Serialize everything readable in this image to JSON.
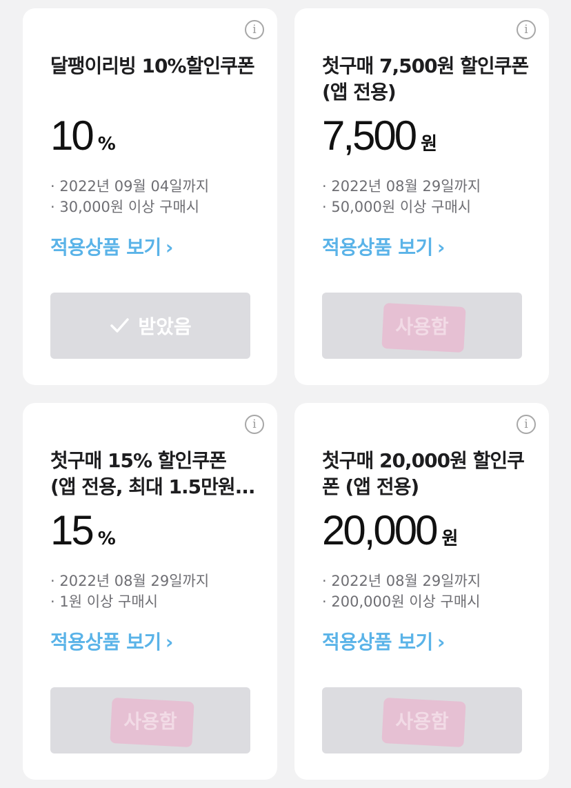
{
  "coupons": [
    {
      "title": "달팽이리빙 10%할인쿠폰",
      "amount": "10",
      "unit": "%",
      "expiry": "2022년 09월 04일까지",
      "min_purchase": "30,000원 이상 구매시",
      "link": "적용상품 보기",
      "status": "받았음",
      "status_type": "received"
    },
    {
      "title": "첫구매 7,500원 할인쿠폰 (앱 전용)",
      "amount": "7,500",
      "unit": "원",
      "expiry": "2022년 08월 29일까지",
      "min_purchase": "50,000원 이상 구매시",
      "link": "적용상품 보기",
      "status": "사용함",
      "status_type": "used"
    },
    {
      "title": "첫구매 15% 할인쿠폰 (앱 전용, 최대 1.5만원...",
      "amount": "15",
      "unit": "%",
      "expiry": "2022년 08월 29일까지",
      "min_purchase": "1원 이상 구매시",
      "link": "적용상품 보기",
      "status": "사용함",
      "status_type": "used"
    },
    {
      "title": "첫구매 20,000원 할인쿠폰 (앱 전용)",
      "amount": "20,000",
      "unit": "원",
      "expiry": "2022년 08월 29일까지",
      "min_purchase": "200,000원 이상 구매시",
      "link": "적용상품 보기",
      "status": "사용함",
      "status_type": "used"
    }
  ],
  "icons": {
    "info": "info-circle-icon",
    "check": "check-icon",
    "chevron": "chevron-right-icon"
  },
  "colors": {
    "link": "#5ab3e8",
    "button_bg": "#dcdce0",
    "used_stamp": "#eeaac8"
  }
}
